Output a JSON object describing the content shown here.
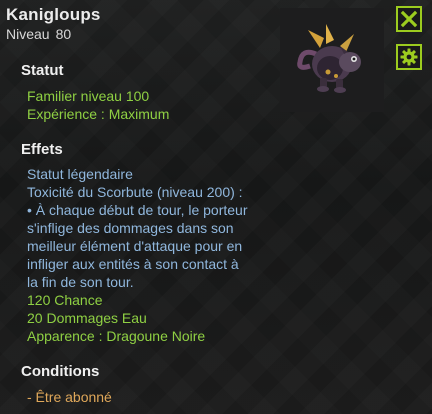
{
  "header": {
    "name": "Kanigloups",
    "level_label": "Niveau",
    "level_value": "80"
  },
  "statut": {
    "title": "Statut",
    "lines": [
      "Familier niveau 100",
      "Expérience : Maximum"
    ]
  },
  "effets": {
    "title": "Effets",
    "description_lines": [
      "Statut légendaire",
      "Toxicité du Scorbute (niveau 200) :",
      "• À chaque début de tour, le porteur",
      "s'inflige des dommages dans son",
      "meilleur élément d'attaque pour en",
      "infliger aux entités à son contact à",
      "la fin de son tour."
    ],
    "stat_lines": [
      "120 Chance",
      "20 Dommages Eau",
      "Apparence : Dragoune Noire"
    ]
  },
  "conditions": {
    "title": "Conditions",
    "lines": [
      "- Être abonné"
    ]
  },
  "icons": {
    "close": "close-icon",
    "gear": "gear-icon"
  },
  "colors": {
    "accent": "#9ccc1f",
    "effect_text": "#8fd043",
    "description_text": "#90b7dd",
    "condition_text": "#e0a85a"
  }
}
